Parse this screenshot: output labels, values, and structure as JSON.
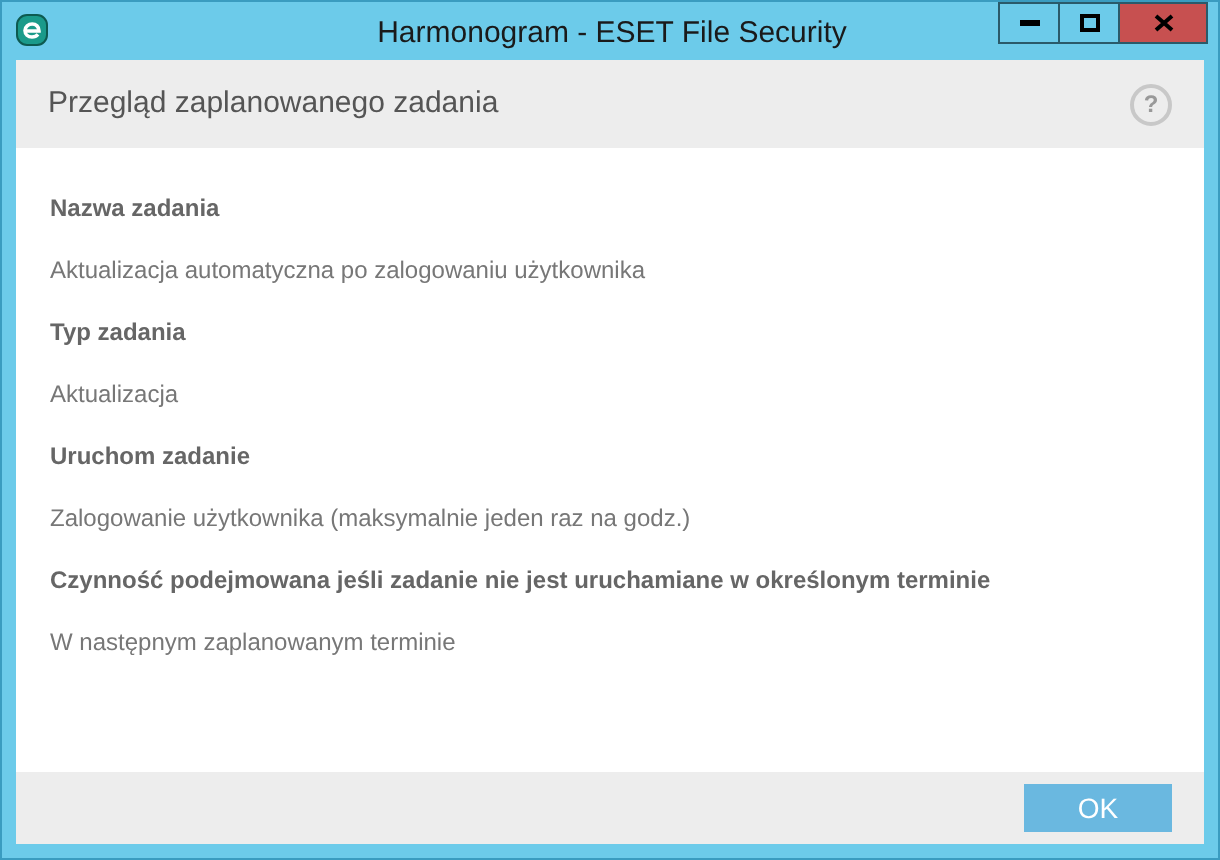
{
  "window": {
    "title": "Harmonogram - ESET File Security"
  },
  "header": {
    "title": "Przegląd zaplanowanego zadania",
    "help": "?"
  },
  "details": [
    {
      "kind": "label",
      "text": "Nazwa zadania"
    },
    {
      "kind": "value",
      "text": "Aktualizacja automatyczna po zalogowaniu użytkownika"
    },
    {
      "kind": "label",
      "text": "Typ zadania"
    },
    {
      "kind": "value",
      "text": "Aktualizacja"
    },
    {
      "kind": "label",
      "text": "Uruchom zadanie"
    },
    {
      "kind": "value",
      "text": "Zalogowanie użytkownika (maksymalnie jeden raz na godz.)"
    },
    {
      "kind": "label",
      "text": "Czynność podejmowana jeśli zadanie nie jest uruchamiane w określonym terminie"
    },
    {
      "kind": "value",
      "text": "W następnym zaplanowanym terminie"
    }
  ],
  "buttons": [
    "OK"
  ]
}
